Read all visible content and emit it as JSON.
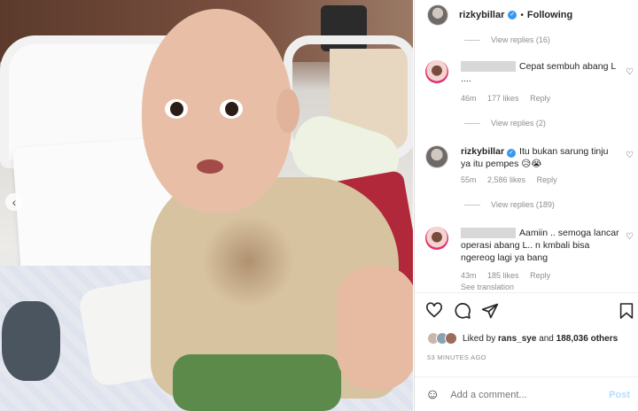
{
  "header": {
    "username": "rizkybillar",
    "separator": "•",
    "follow_status": "Following"
  },
  "comments": [
    {
      "type": "view_replies",
      "text": "View replies (16)"
    },
    {
      "type": "comment",
      "author_hidden": true,
      "text": "Cepat sembuh abang L ....",
      "time": "46m",
      "likes": "177 likes",
      "reply": "Reply"
    },
    {
      "type": "view_replies",
      "text": "View replies (2)"
    },
    {
      "type": "comment",
      "author": "rizkybillar",
      "text": "Itu bukan sarung tinju ya itu pempes 😥😭",
      "time": "55m",
      "likes": "2,586 likes",
      "reply": "Reply"
    },
    {
      "type": "view_replies",
      "text": "View replies (189)"
    },
    {
      "type": "comment",
      "author_hidden": true,
      "text": "Aamiin .. semoga lancar operasi abang L.. n kmbali bisa ngereog lagi ya bang",
      "time": "43m",
      "likes": "185 likes",
      "reply": "Reply",
      "extra": "See translation"
    }
  ],
  "likes": {
    "prefix": "Liked by",
    "user": "rans_sye",
    "joiner": "and",
    "others": "188,036 others"
  },
  "timestamp": "53 MINUTES AGO",
  "add_comment": {
    "placeholder": "Add a comment...",
    "post_label": "Post"
  },
  "icons": {
    "heart": "heart-icon",
    "comment": "comment-icon",
    "share": "share-icon",
    "save": "bookmark-icon",
    "emoji": "smile-icon"
  },
  "colors": {
    "verified": "#3897f0",
    "post_disabled": "#b2dffc",
    "muted": "#8e8e8e"
  }
}
